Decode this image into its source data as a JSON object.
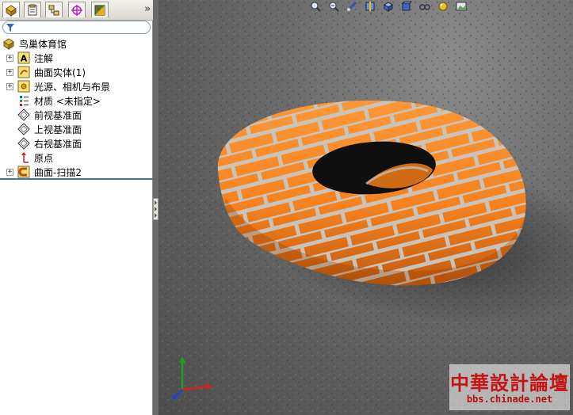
{
  "feature_tree": {
    "root": {
      "label": "鸟巢体育馆",
      "icon": "part-icon"
    },
    "items": [
      {
        "label": "注解",
        "icon": "annotations-icon",
        "expandable": true
      },
      {
        "label": "曲面实体(1)",
        "icon": "surface-bodies-icon",
        "expandable": true
      },
      {
        "label": "光源、相机与布景",
        "icon": "lights-cameras-icon",
        "expandable": true
      },
      {
        "label": "材质 <未指定>",
        "icon": "material-icon",
        "expandable": false
      },
      {
        "label": "前视基准面",
        "icon": "plane-icon",
        "expandable": false
      },
      {
        "label": "上视基准面",
        "icon": "plane-icon",
        "expandable": false
      },
      {
        "label": "右视基准面",
        "icon": "plane-icon",
        "expandable": false
      },
      {
        "label": "原点",
        "icon": "origin-icon",
        "expandable": false
      },
      {
        "label": "曲面-扫描2",
        "icon": "sweep-surface-icon",
        "expandable": true
      }
    ]
  },
  "tabs": [
    {
      "name": "feature-manager",
      "icon": "feature-manager-icon",
      "active": true
    },
    {
      "name": "property-manager",
      "icon": "property-manager-icon",
      "active": false
    },
    {
      "name": "configuration-manager",
      "icon": "configuration-manager-icon",
      "active": false
    },
    {
      "name": "dimxpert-manager",
      "icon": "dimxpert-icon",
      "active": false
    },
    {
      "name": "display-manager",
      "icon": "display-manager-icon",
      "active": false
    }
  ],
  "collapse_label": "»",
  "filter": {
    "icon": "filter-icon",
    "value": ""
  },
  "toolbar": [
    "zoom-to-fit-icon",
    "zoom-area-icon",
    "previous-view-icon",
    "section-view-icon",
    "view-orientation-icon",
    "display-style-icon",
    "hide-show-icon",
    "appearance-icon",
    "scene-icon"
  ],
  "model": {
    "description_colors": {
      "brick": "#f7821e",
      "mortar": "#c8c4bc",
      "floor": "#6a6a6a"
    }
  },
  "watermark": {
    "title": "中華設計論壇",
    "url": "bbs.chinade.net"
  },
  "triad": {
    "x_color": "#d42020",
    "y_color": "#20a020",
    "z_color": "#2040d0"
  }
}
